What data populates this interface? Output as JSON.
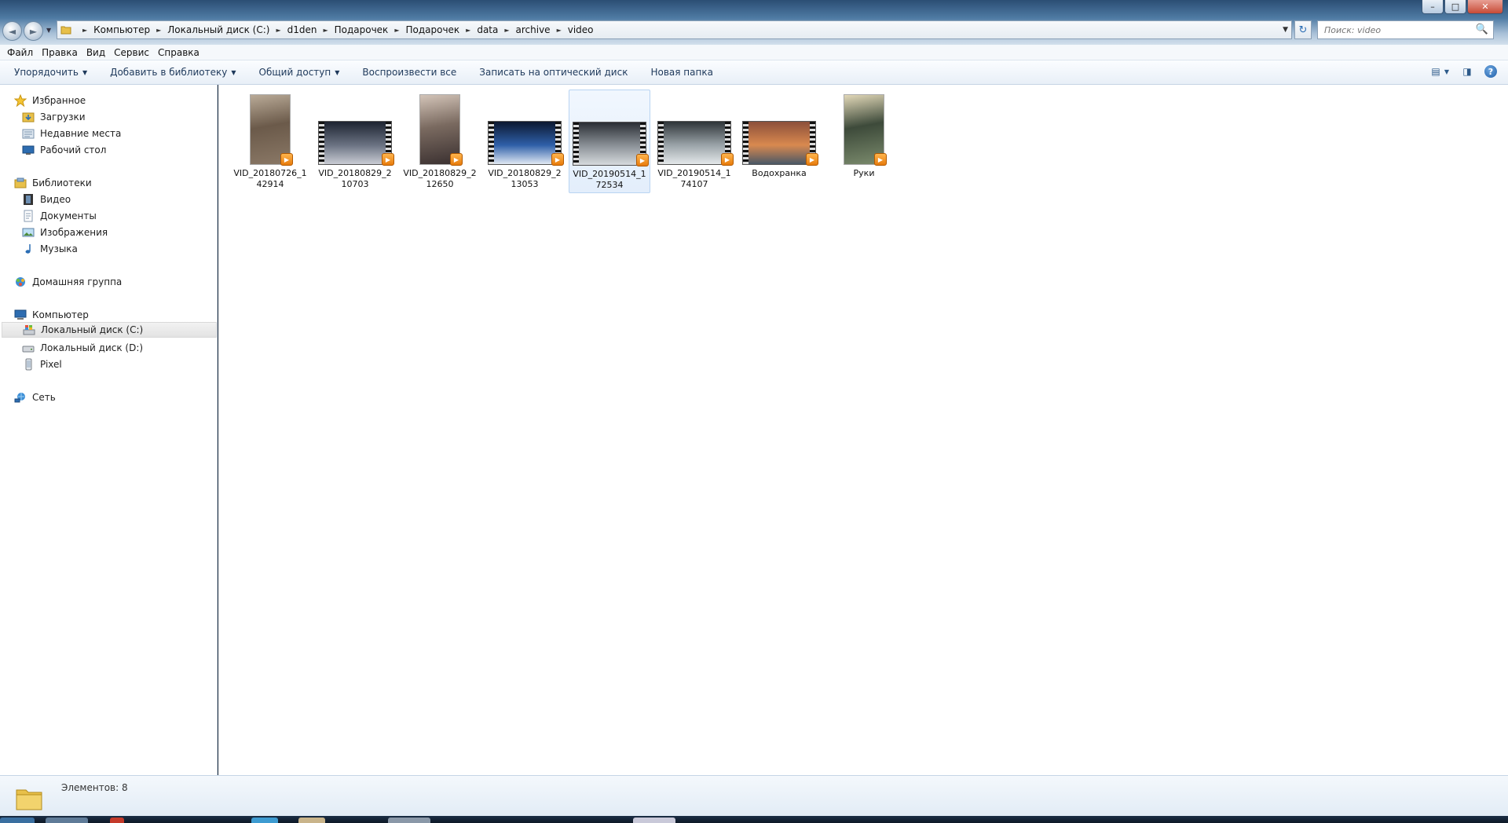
{
  "window": {
    "controls": {
      "minimize": "–",
      "maximize": "□",
      "close": "✕"
    }
  },
  "nav": {
    "back": "◄",
    "forward": "►",
    "dropdown": "▼"
  },
  "address": {
    "crumbs": [
      "Компьютер",
      "Локальный диск (C:)",
      "d1den",
      "Подарочек",
      "Подарочек",
      "data",
      "archive",
      "video"
    ],
    "separator": "►",
    "dropdown": "▼",
    "refresh": "↻"
  },
  "search": {
    "placeholder": "Поиск: video",
    "icon": "🔍"
  },
  "menu": [
    "Файл",
    "Правка",
    "Вид",
    "Сервис",
    "Справка"
  ],
  "toolbar": {
    "organize": "Упорядочить",
    "add_to_library": "Добавить в библиотеку",
    "share": "Общий доступ",
    "play_all": "Воспроизвести все",
    "burn": "Записать на оптический диск",
    "new_folder": "Новая папка",
    "arrow": "▼",
    "view_icon": "▤",
    "preview_icon": "◨",
    "help_icon": "?"
  },
  "sidebar": {
    "favorites": {
      "label": "Избранное",
      "items": [
        "Загрузки",
        "Недавние места",
        "Рабочий стол"
      ]
    },
    "libraries": {
      "label": "Библиотеки",
      "items": [
        "Видео",
        "Документы",
        "Изображения",
        "Музыка"
      ]
    },
    "homegroup": {
      "label": "Домашняя группа"
    },
    "computer": {
      "label": "Компьютер",
      "items": [
        "Локальный диск (C:)",
        "Локальный диск (D:)",
        "Pixel"
      ],
      "selected": "Локальный диск (C:)"
    },
    "network": {
      "label": "Сеть"
    }
  },
  "files": [
    {
      "name": "VID_20180726_142914",
      "orientation": "portrait",
      "colors": [
        "#6b5a4a",
        "#b9aa97",
        "#8a7866"
      ]
    },
    {
      "name": "VID_20180829_210703",
      "orientation": "landscape",
      "colors": [
        "#1d2330",
        "#6a7282",
        "#c9ccd4"
      ]
    },
    {
      "name": "VID_20180829_212650",
      "orientation": "portrait",
      "colors": [
        "#7a6a60",
        "#d3c4b8",
        "#3a3030"
      ]
    },
    {
      "name": "VID_20180829_213053",
      "orientation": "landscape",
      "colors": [
        "#0c1830",
        "#2e5fa8",
        "#e0e8f4"
      ]
    },
    {
      "name": "VID_20190514_172534",
      "orientation": "landscape",
      "colors": [
        "#2a2e34",
        "#8c9298",
        "#d6dadd"
      ],
      "selected": true
    },
    {
      "name": "VID_20190514_174107",
      "orientation": "landscape",
      "colors": [
        "#2e3438",
        "#9aa3a8",
        "#e4e8ea"
      ]
    },
    {
      "name": "Водохранка",
      "orientation": "landscape",
      "colors": [
        "#8c4f3a",
        "#d9894f",
        "#4a5866"
      ]
    },
    {
      "name": "Руки",
      "orientation": "portrait",
      "colors": [
        "#3d4a3a",
        "#e2d8b8",
        "#7a8a6c"
      ]
    }
  ],
  "status": {
    "count": "Элементов: 8"
  }
}
